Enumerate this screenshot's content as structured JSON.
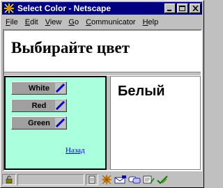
{
  "window": {
    "title": "Select Color - Netscape",
    "app_icon": "netscape-icon",
    "controls": [
      "minimize-icon",
      "maximize-icon",
      "close-icon"
    ]
  },
  "menu": {
    "items": [
      {
        "first": "F",
        "rest": "ile"
      },
      {
        "first": "E",
        "rest": "dit"
      },
      {
        "first": "V",
        "rest": "iew"
      },
      {
        "first": "G",
        "rest": "o"
      },
      {
        "first": "C",
        "rest": "ommunicator"
      },
      {
        "first": "H",
        "rest": "elp"
      }
    ]
  },
  "top_frame": {
    "heading": "Выбирайте цвет"
  },
  "left_frame": {
    "buttons": [
      {
        "label": "White"
      },
      {
        "label": "Red"
      },
      {
        "label": "Green"
      }
    ],
    "back_link": "Назад",
    "background": "#aaffdd"
  },
  "right_frame": {
    "heading": "Белый"
  },
  "status_bar": {
    "icons": [
      "security-lock-icon",
      "document-icon",
      "navigator-icon",
      "mail-icon",
      "chat-icon",
      "composer-icon",
      "checkmark-icon"
    ]
  }
}
